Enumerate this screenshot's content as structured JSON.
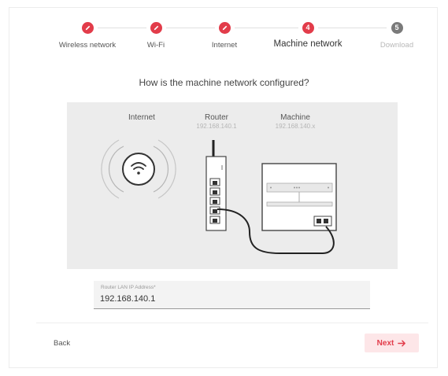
{
  "stepper": {
    "steps": [
      {
        "label": "Wireless network",
        "status": "done",
        "icon": "pencil-icon"
      },
      {
        "label": "Wi-Fi",
        "status": "done",
        "icon": "pencil-icon"
      },
      {
        "label": "Internet",
        "status": "done",
        "icon": "pencil-icon"
      },
      {
        "label": "Machine network",
        "status": "current",
        "number": "4"
      },
      {
        "label": "Download",
        "status": "disabled",
        "number": "5"
      }
    ]
  },
  "question": "How is the machine network configured?",
  "diagram": {
    "internet_label": "Internet",
    "router_label": "Router",
    "router_ip": "192.168.140.1",
    "machine_label": "Machine",
    "machine_ip": "192.168.140.x"
  },
  "form": {
    "router_ip_label": "Router LAN IP Address*",
    "router_ip_value": "192.168.140.1"
  },
  "footer": {
    "back_label": "Back",
    "next_label": "Next"
  },
  "colors": {
    "accent": "#e23c4a",
    "accent_light": "#fde6e8",
    "disabled": "#7a7a7a",
    "diagram_bg": "#ececec"
  }
}
